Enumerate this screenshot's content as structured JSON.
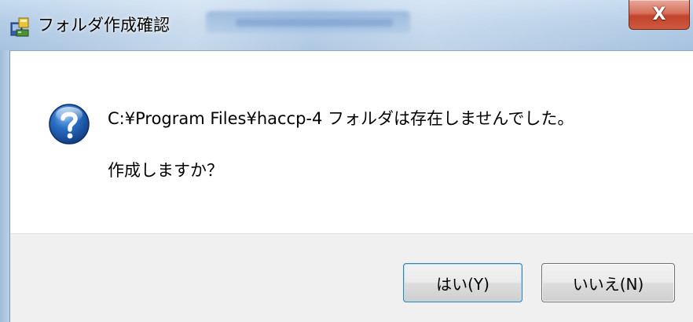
{
  "window": {
    "title": "フォルダ作成確認",
    "close_label": "X"
  },
  "icons": {
    "app": "app-setup-icon",
    "message": "question-icon"
  },
  "message": {
    "line1": "C:¥Program Files¥haccp-4 フォルダは存在しませんでした。",
    "line2": "作成しますか？"
  },
  "buttons": {
    "yes_label": "はい(Y)",
    "no_label": "いいえ(N)"
  },
  "colors": {
    "close_button": "#c1432b",
    "button_bar": "#f0f0f0",
    "question_icon": "#1f5fb0"
  }
}
